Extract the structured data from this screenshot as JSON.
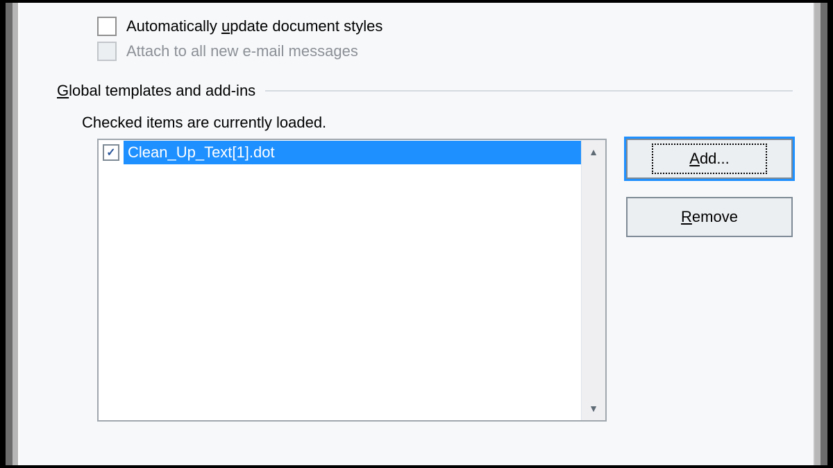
{
  "checks": {
    "auto_update": "Automatically update document styles",
    "auto_update_accel": "u",
    "attach_email": "Attach to all new e-mail messages"
  },
  "group": {
    "title": "Global templates and add-ins",
    "title_accel": "G",
    "subcaption": "Checked items are currently loaded."
  },
  "list": {
    "item0": "Clean_Up_Text[1].dot"
  },
  "buttons": {
    "add": "Add...",
    "add_accel": "A",
    "remove": "Remove",
    "remove_accel": "R"
  }
}
